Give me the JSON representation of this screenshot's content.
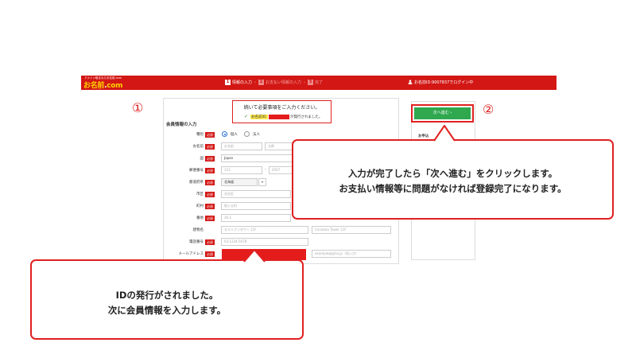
{
  "header": {
    "logo_small": "ドメイン取るならお名前.com",
    "logo_main": "お名前",
    "logo_dot": ".",
    "logo_com": "com",
    "steps": [
      {
        "num": "1",
        "label": "情報の入力"
      },
      {
        "num": "2",
        "label": "お支払い情報の入力"
      },
      {
        "num": "3",
        "label": "完了"
      }
    ],
    "login_text": "お名前ID:9007837でログイン中",
    "accent_color": "#d21714"
  },
  "form": {
    "notice_title": "続いて必要事項をご入力ください。",
    "notice_id_label": "お名前ID:",
    "notice_issued": "が発行されました。",
    "section_title": "会員情報の入力",
    "required_badge": "必須",
    "rows": {
      "type": {
        "label": "種別",
        "option_personal": "個人",
        "option_corporate": "法人",
        "selected": "個人"
      },
      "name": {
        "label": "お名前",
        "placeholder_last": "お名前",
        "placeholder_first": "太郎"
      },
      "country": {
        "label": "国",
        "value": "Japan"
      },
      "postal": {
        "label": "郵便番号",
        "placeholder_1": "123",
        "placeholder_2": "4567"
      },
      "prefecture": {
        "label": "都道府県",
        "value": "北海道"
      },
      "city": {
        "label": "市区",
        "placeholder": "渋谷区"
      },
      "town": {
        "label": "町村",
        "placeholder": "桜ヶ丘町"
      },
      "address": {
        "label": "番地",
        "placeholder": "26-1"
      },
      "building": {
        "label": "建物名",
        "placeholder_jp": "セルリアンタワー 11F",
        "placeholder_en": "Cerulean Tower 11F"
      },
      "phone": {
        "label": "電話番号",
        "placeholder": "03-1234-5678"
      },
      "email": {
        "label": "メールアドレス",
        "placeholder": "example@gmo.jp（同入力）"
      }
    }
  },
  "side": {
    "next_button": "次へ進む ›",
    "summary_label": "お申込"
  },
  "markers": {
    "one": "①",
    "two": "②"
  },
  "callouts": {
    "next": {
      "line1": "入力が完了したら「次へ進む」をクリックします。",
      "line2": "お支払い情報等に問題がなければ登録完了になります。"
    },
    "id": {
      "line1": "IDの発行がされました。",
      "line2": "次に会員情報を入力します。"
    }
  },
  "colors": {
    "highlight_red": "#e02020",
    "button_green": "#2fa84f",
    "badge_yellow": "#ffe94d"
  }
}
